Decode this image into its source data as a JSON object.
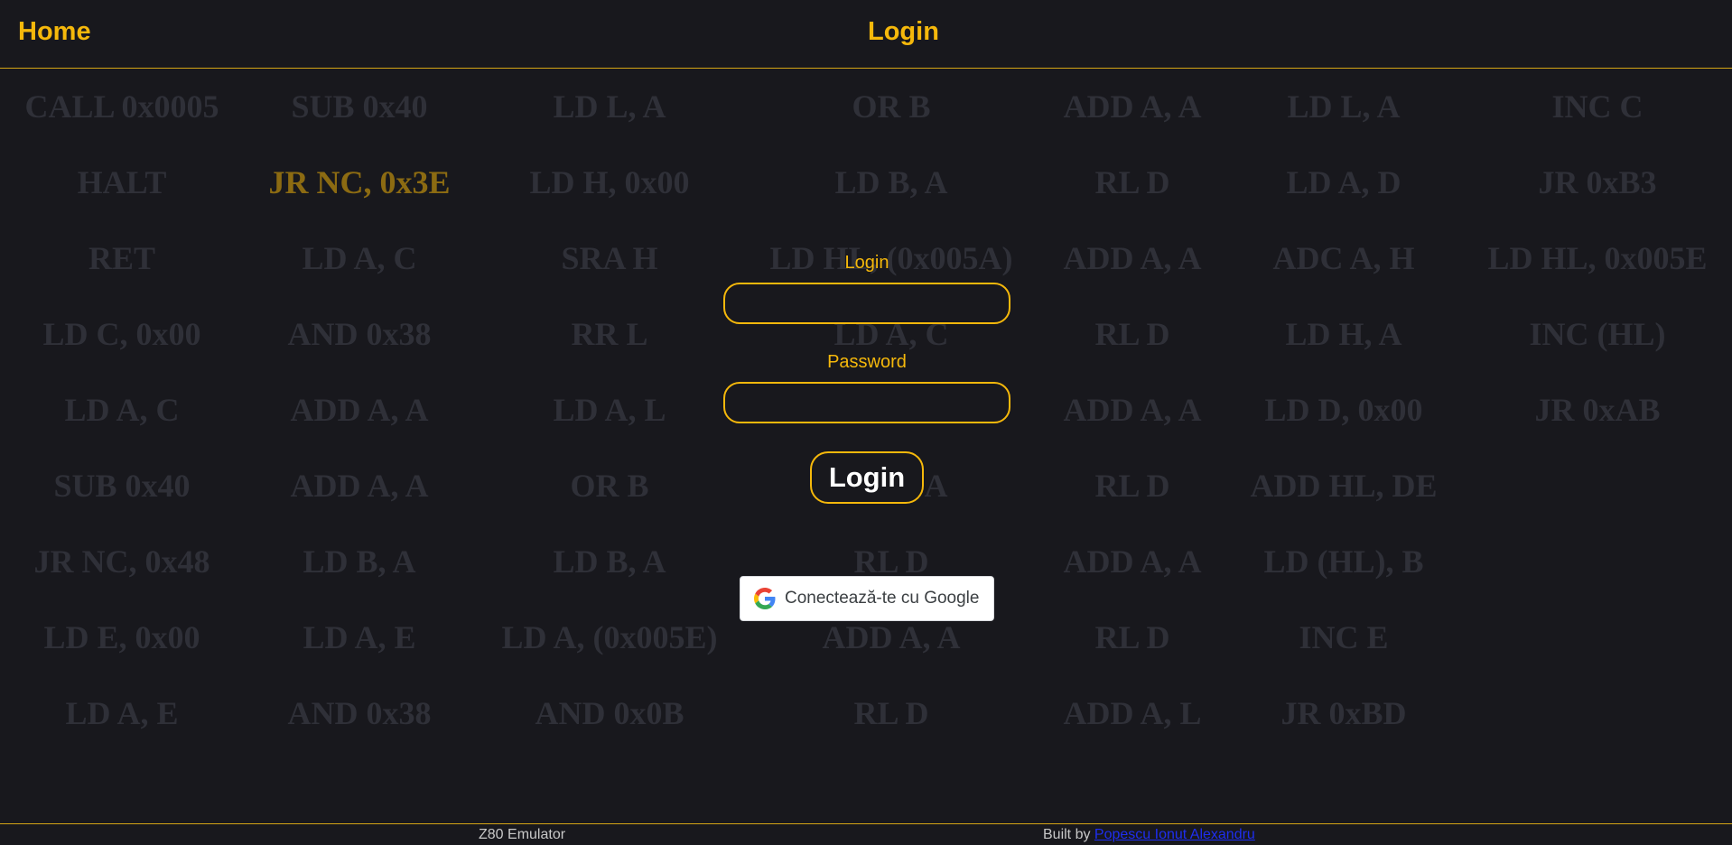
{
  "header": {
    "home_label": "Home",
    "title": "Login"
  },
  "background_instructions": [
    [
      "CALL 0x0005",
      "SUB 0x40",
      "LD L, A",
      "OR B",
      "ADD A, A",
      "LD L, A",
      "INC C"
    ],
    [
      "HALT",
      "JR NC, 0x3E",
      "LD H, 0x00",
      "LD B, A",
      "RL D",
      "LD A, D",
      "JR 0xB3"
    ],
    [
      "RET",
      "LD A, C",
      "SRA H",
      "LD HL, (0x005A)",
      "ADD A, A",
      "ADC A, H",
      "LD HL, 0x005E"
    ],
    [
      "LD C, 0x00",
      "AND 0x38",
      "RR L",
      "LD A, C",
      "RL D",
      "LD H, A",
      "INC (HL)"
    ],
    [
      "LD A, C",
      "ADD A, A",
      "LD A, L",
      "",
      "ADD A, A",
      "LD D, 0x00",
      "JR 0xAB"
    ],
    [
      "SUB 0x40",
      "ADD A, A",
      "OR B",
      "LD A, A",
      "RL D",
      "ADD HL, DE",
      ""
    ],
    [
      "JR NC, 0x48",
      "LD B, A",
      "LD B, A",
      "RL D",
      "ADD A, A",
      "LD (HL), B",
      ""
    ],
    [
      "LD E, 0x00",
      "LD A, E",
      "LD A, (0x005E)",
      "ADD A, A",
      "RL D",
      "INC E",
      ""
    ],
    [
      "LD A, E",
      "AND 0x38",
      "AND 0x0B",
      "RL D",
      "ADD A, L",
      "JR 0xBD",
      ""
    ]
  ],
  "highlighted_instruction": "JR NC, 0x3E",
  "form": {
    "login_label": "Login",
    "login_value": "",
    "password_label": "Password",
    "password_value": "",
    "submit_label": "Login",
    "google_label": "Conectează-te cu Google"
  },
  "footer": {
    "app_name": "Z80 Emulator",
    "built_by_prefix": "Built by ",
    "author": "Popescu Ionut Alexandru"
  },
  "colors": {
    "accent": "#f5b80b",
    "background": "#18181d",
    "background_text": "#2f3038",
    "highlight_text": "#8c6b12",
    "link": "#1e2ef0"
  }
}
